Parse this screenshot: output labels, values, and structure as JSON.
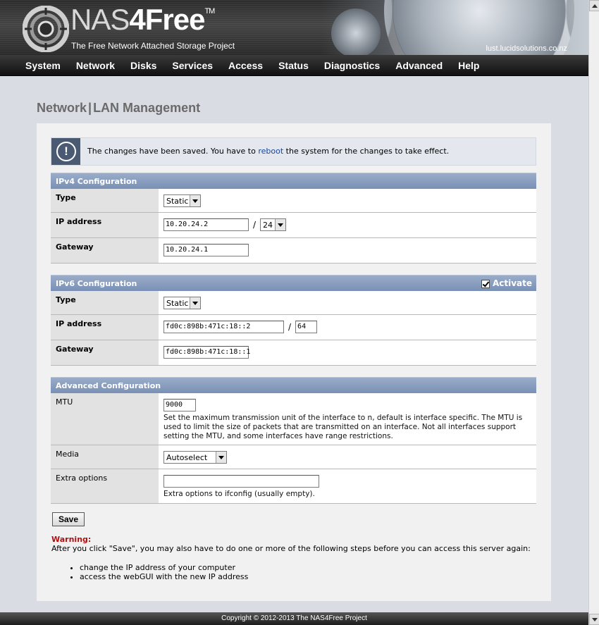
{
  "header": {
    "logo_nas": "NAS",
    "logo_four": "4Free",
    "logo_tm": "TM",
    "tagline": "The Free Network Attached Storage Project",
    "hostname": "lust.lucidsolutions.co.nz"
  },
  "nav": [
    "System",
    "Network",
    "Disks",
    "Services",
    "Access",
    "Status",
    "Diagnostics",
    "Advanced",
    "Help"
  ],
  "page": {
    "title_left": "Network",
    "title_sep": "|",
    "title_right": "LAN Management"
  },
  "notice": {
    "icon": "!",
    "text_before": "The changes have been saved. You have to ",
    "link": "reboot",
    "text_after": " the system for the changes to take effect."
  },
  "ipv4": {
    "header": "IPv4 Configuration",
    "type_label": "Type",
    "type_value": "Static",
    "ip_label": "IP address",
    "ip_value": "10.20.24.2",
    "slash": "/",
    "mask_value": "24",
    "gateway_label": "Gateway",
    "gateway_value": "10.20.24.1"
  },
  "ipv6": {
    "header": "IPv6 Configuration",
    "activate_label": "Activate",
    "type_label": "Type",
    "type_value": "Static",
    "ip_label": "IP address",
    "ip_value": "fd0c:898b:471c:18::2",
    "slash": "/",
    "prefix_value": "64",
    "gateway_label": "Gateway",
    "gateway_value": "fd0c:898b:471c:18::1"
  },
  "advanced": {
    "header": "Advanced Configuration",
    "mtu_label": "MTU",
    "mtu_value": "9000",
    "mtu_desc": "Set the maximum transmission unit of the interface to n, default is interface specific. The MTU is used to limit the size of packets that are transmitted on an interface. Not all interfaces support setting the MTU, and some interfaces have range restrictions.",
    "media_label": "Media",
    "media_value": "Autoselect",
    "extra_label": "Extra options",
    "extra_value": "",
    "extra_desc": "Extra options to ifconfig (usually empty)."
  },
  "save_label": "Save",
  "warning": {
    "title": "Warning:",
    "text": "After you click \"Save\", you may also have to do one or more of the following steps before you can access this server again:",
    "items": [
      "change the IP address of your computer",
      "access the webGUI with the new IP address"
    ]
  },
  "footer": "Copyright © 2012-2013 The NAS4Free Project",
  "colors": {
    "section_header": "#7990b6",
    "notice_icon_bg": "#4b5a73",
    "warning_title": "#b01010",
    "link": "#17449a"
  }
}
